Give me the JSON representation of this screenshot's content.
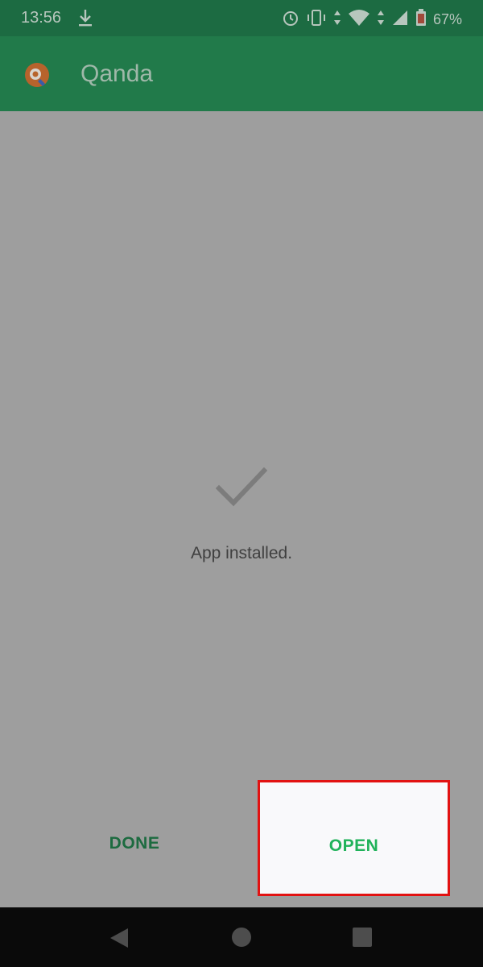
{
  "status_bar": {
    "time": "13:56",
    "battery_percent": "67%",
    "icons": [
      "download-icon",
      "alarm-icon",
      "vibrate-icon",
      "data-arrows-icon",
      "wifi-icon",
      "signal-icon",
      "battery-icon"
    ]
  },
  "app_bar": {
    "title": "Qanda",
    "logo": "qanda-logo-icon"
  },
  "dialog": {
    "status_icon": "check-icon",
    "message": "App installed."
  },
  "actions": {
    "done_label": "DONE",
    "open_label": "OPEN",
    "open_highlight_color": "#e21212"
  },
  "nav_bar": {
    "buttons": [
      "back-icon",
      "home-icon",
      "recents-icon"
    ]
  },
  "colors": {
    "status_bar": "#1c6b42",
    "app_bar": "#217a4a",
    "scrim": "#9e9e9e",
    "accent_green": "#20b25a"
  }
}
